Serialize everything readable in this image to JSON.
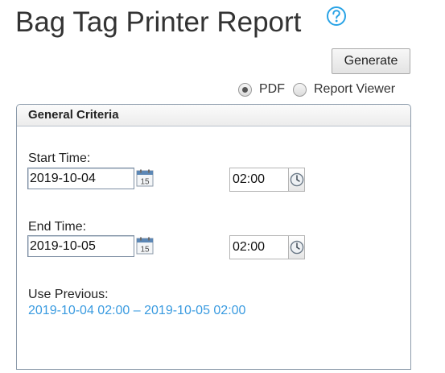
{
  "header": {
    "title": "Bag Tag Printer Report",
    "help_icon": "question-circle-icon"
  },
  "toolbar": {
    "generate_label": "Generate"
  },
  "output_format": {
    "options": [
      {
        "label": "PDF",
        "checked": true
      },
      {
        "label": "Report Viewer",
        "checked": false
      }
    ]
  },
  "criteria": {
    "panel_title": "General Criteria",
    "start": {
      "label": "Start Time:",
      "date": "2019-10-04",
      "time": "02:00",
      "calendar_icon_text": "15"
    },
    "end": {
      "label": "End Time:",
      "date": "2019-10-05",
      "time": "02:00",
      "calendar_icon_text": "15"
    },
    "previous": {
      "label": "Use Previous:",
      "value": "2019-10-04 02:00 – 2019-10-05 02:00"
    }
  },
  "colors": {
    "accent_link": "#3a9be0",
    "help_icon": "#29a3e6",
    "panel_border": "#8c9bab"
  }
}
